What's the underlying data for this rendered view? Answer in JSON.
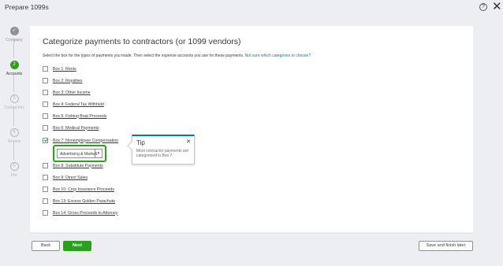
{
  "window": {
    "title": "Prepare 1099s",
    "help_icon": "?",
    "close_icon": "✕"
  },
  "steps": [
    {
      "label": "Company",
      "marker": "✓",
      "state": "done"
    },
    {
      "label": "Accounts",
      "marker": "2",
      "state": "current"
    },
    {
      "label": "Contractors",
      "marker": "3",
      "state": "todo"
    },
    {
      "label": "Review",
      "marker": "4",
      "state": "todo"
    },
    {
      "label": "File",
      "marker": "5",
      "state": "todo"
    }
  ],
  "main": {
    "heading": "Categorize payments to contractors (or 1099 vendors)",
    "instruction": "Select the box for the types of payments you made. Then select the expense accounts you use for these payments. ",
    "help_link": "Not sure which categories to choose?",
    "boxes": [
      {
        "label": "Box 1: Rents",
        "checked": false
      },
      {
        "label": "Box 2: Royalties",
        "checked": false
      },
      {
        "label": "Box 3: Other Income",
        "checked": false
      },
      {
        "label": "Box 4: Federal Tax Withheld",
        "checked": false
      },
      {
        "label": "Box 5: Fishing Boat Proceeds",
        "checked": false
      },
      {
        "label": "Box 6: Medical Payments",
        "checked": false
      },
      {
        "label": "Box 7: Nonemployee Compensation",
        "checked": true
      },
      {
        "label": "Box 8: Substitute Payments",
        "checked": false
      },
      {
        "label": "Box 9: Direct Sales",
        "checked": false
      },
      {
        "label": "Box 10: Crop Insurance Proceeds",
        "checked": false
      },
      {
        "label": "Box 13: Excess Golden Parachute",
        "checked": false
      },
      {
        "label": "Box 14: Gross Proceeds to Attorney",
        "checked": false
      }
    ],
    "account_select": {
      "value": "Advertising & Marketi",
      "arrow": "▾"
    }
  },
  "tip": {
    "title": "Tip",
    "close": "✕",
    "body": "Most contractor payments are categorized in Box 7."
  },
  "footer": {
    "back": "Back",
    "next": "Next",
    "save": "Save and finish later"
  },
  "colors": {
    "accent": "#2ca01c",
    "link": "#0077c5",
    "text": "#393a3d"
  }
}
